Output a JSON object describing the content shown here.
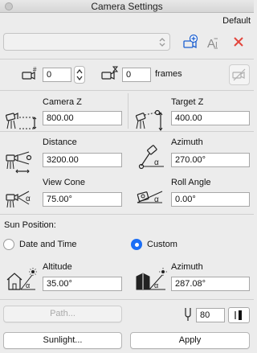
{
  "window": {
    "title": "Camera Settings"
  },
  "header": {
    "default_label": "Default",
    "preset_value": ""
  },
  "frame_row": {
    "camera_index": "0",
    "frame_count": "0",
    "frames_label": "frames"
  },
  "camera_z": {
    "label": "Camera Z",
    "value": "800.00"
  },
  "target_z": {
    "label": "Target Z",
    "value": "400.00"
  },
  "distance": {
    "label": "Distance",
    "value": "3200.00"
  },
  "azimuth": {
    "label": "Azimuth",
    "value": "270.00°"
  },
  "view_cone": {
    "label": "View Cone",
    "value": "75.00°"
  },
  "roll_angle": {
    "label": "Roll Angle",
    "value": "0.00°"
  },
  "sun": {
    "section_label": "Sun Position:",
    "date_time_label": "Date and Time",
    "custom_label": "Custom",
    "selected": "Custom",
    "altitude_label": "Altitude",
    "altitude_value": "35.00°",
    "azimuth_label": "Azimuth",
    "azimuth_value": "287.08°"
  },
  "bottom": {
    "path_label": "Path...",
    "pen_value": "80",
    "sunlight_label": "Sunlight...",
    "apply_label": "Apply"
  },
  "colors": {
    "accent": "#1b6ef5",
    "delete_red": "#e2453c"
  }
}
